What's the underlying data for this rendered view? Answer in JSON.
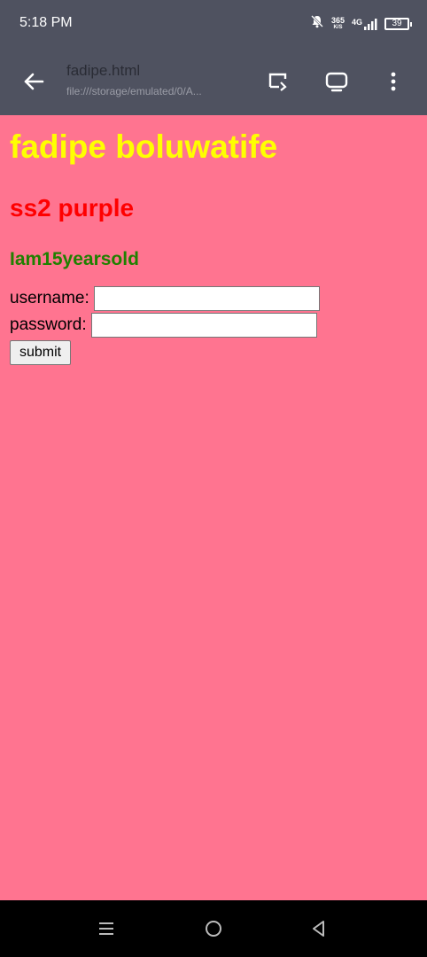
{
  "status_bar": {
    "time": "5:18 PM",
    "speed_value": "365",
    "speed_unit": "K/S",
    "network": "4G",
    "battery": "39",
    "icons": [
      "notifications-off-icon",
      "signal-icon",
      "battery-icon"
    ]
  },
  "toolbar": {
    "title": "fadipe.html",
    "url": "file:///storage/emulated/0/A...",
    "icons": [
      "back-arrow-icon",
      "cast-icon",
      "monitor-icon",
      "more-icon"
    ]
  },
  "content": {
    "heading1": "fadipe boluwatife",
    "heading2": "ss2 purple",
    "heading3": "Iam15yearsold",
    "username_label": "username:",
    "username_value": "",
    "password_label": "password:",
    "password_value": "",
    "submit_label": "submit"
  },
  "nav_bar": {
    "icons": [
      "menu-icon",
      "home-icon",
      "back-icon"
    ]
  },
  "colors": {
    "page_background": "#ff7490",
    "heading1": "#ffff00",
    "heading2": "#ff0000",
    "heading3": "#208000",
    "chrome": "#4f5260"
  }
}
